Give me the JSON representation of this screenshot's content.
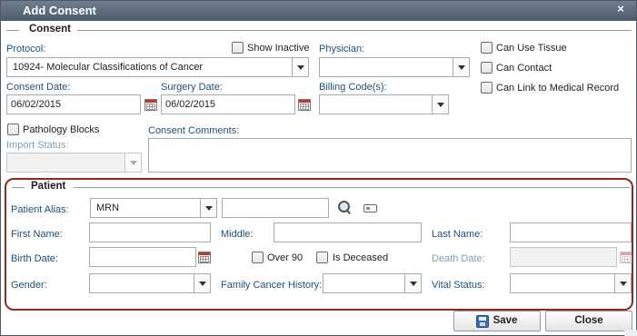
{
  "dialog": {
    "title": "Add Consent",
    "close_glyph": "×"
  },
  "consent": {
    "section_label": "Consent",
    "protocol_label": "Protocol:",
    "protocol_value": "10924- Molecular Classifications of Cancer",
    "show_inactive_label": "Show Inactive",
    "physician_label": "Physician:",
    "physician_value": "",
    "can_use_tissue_label": "Can Use Tissue",
    "can_contact_label": "Can Contact",
    "can_link_label": "Can Link to Medical Record",
    "consent_date_label": "Consent Date:",
    "consent_date_value": "06/02/2015",
    "surgery_date_label": "Surgery Date:",
    "surgery_date_value": "06/02/2015",
    "billing_codes_label": "Billing Code(s):",
    "billing_codes_value": "",
    "pathology_blocks_label": "Pathology Blocks",
    "import_status_label": "Import Status:",
    "import_status_value": "",
    "consent_comments_label": "Consent Comments:"
  },
  "patient": {
    "section_label": "Patient",
    "alias_label": "Patient Alias:",
    "alias_type_value": "MRN",
    "alias_value": "",
    "first_name_label": "First Name:",
    "middle_label": "Middle:",
    "last_name_label": "Last Name:",
    "birth_date_label": "Birth Date:",
    "over_90_label": "Over 90",
    "is_deceased_label": "Is Deceased",
    "death_date_label": "Death Date:",
    "gender_label": "Gender:",
    "gender_value": "",
    "family_cancer_history_label": "Family Cancer History:",
    "family_cancer_history_value": "",
    "vital_status_label": "Vital Status:",
    "vital_status_value": ""
  },
  "footer": {
    "save_label": "Save",
    "close_label": "Close"
  },
  "icons": {
    "calendar": "calendar-icon",
    "search": "magnifier-icon",
    "card": "id-card-icon",
    "save": "floppy-disk-icon"
  },
  "colors": {
    "titlebar": "#5c6b7a",
    "label": "#1f4f7a",
    "patient_border": "#8c2b1e"
  }
}
